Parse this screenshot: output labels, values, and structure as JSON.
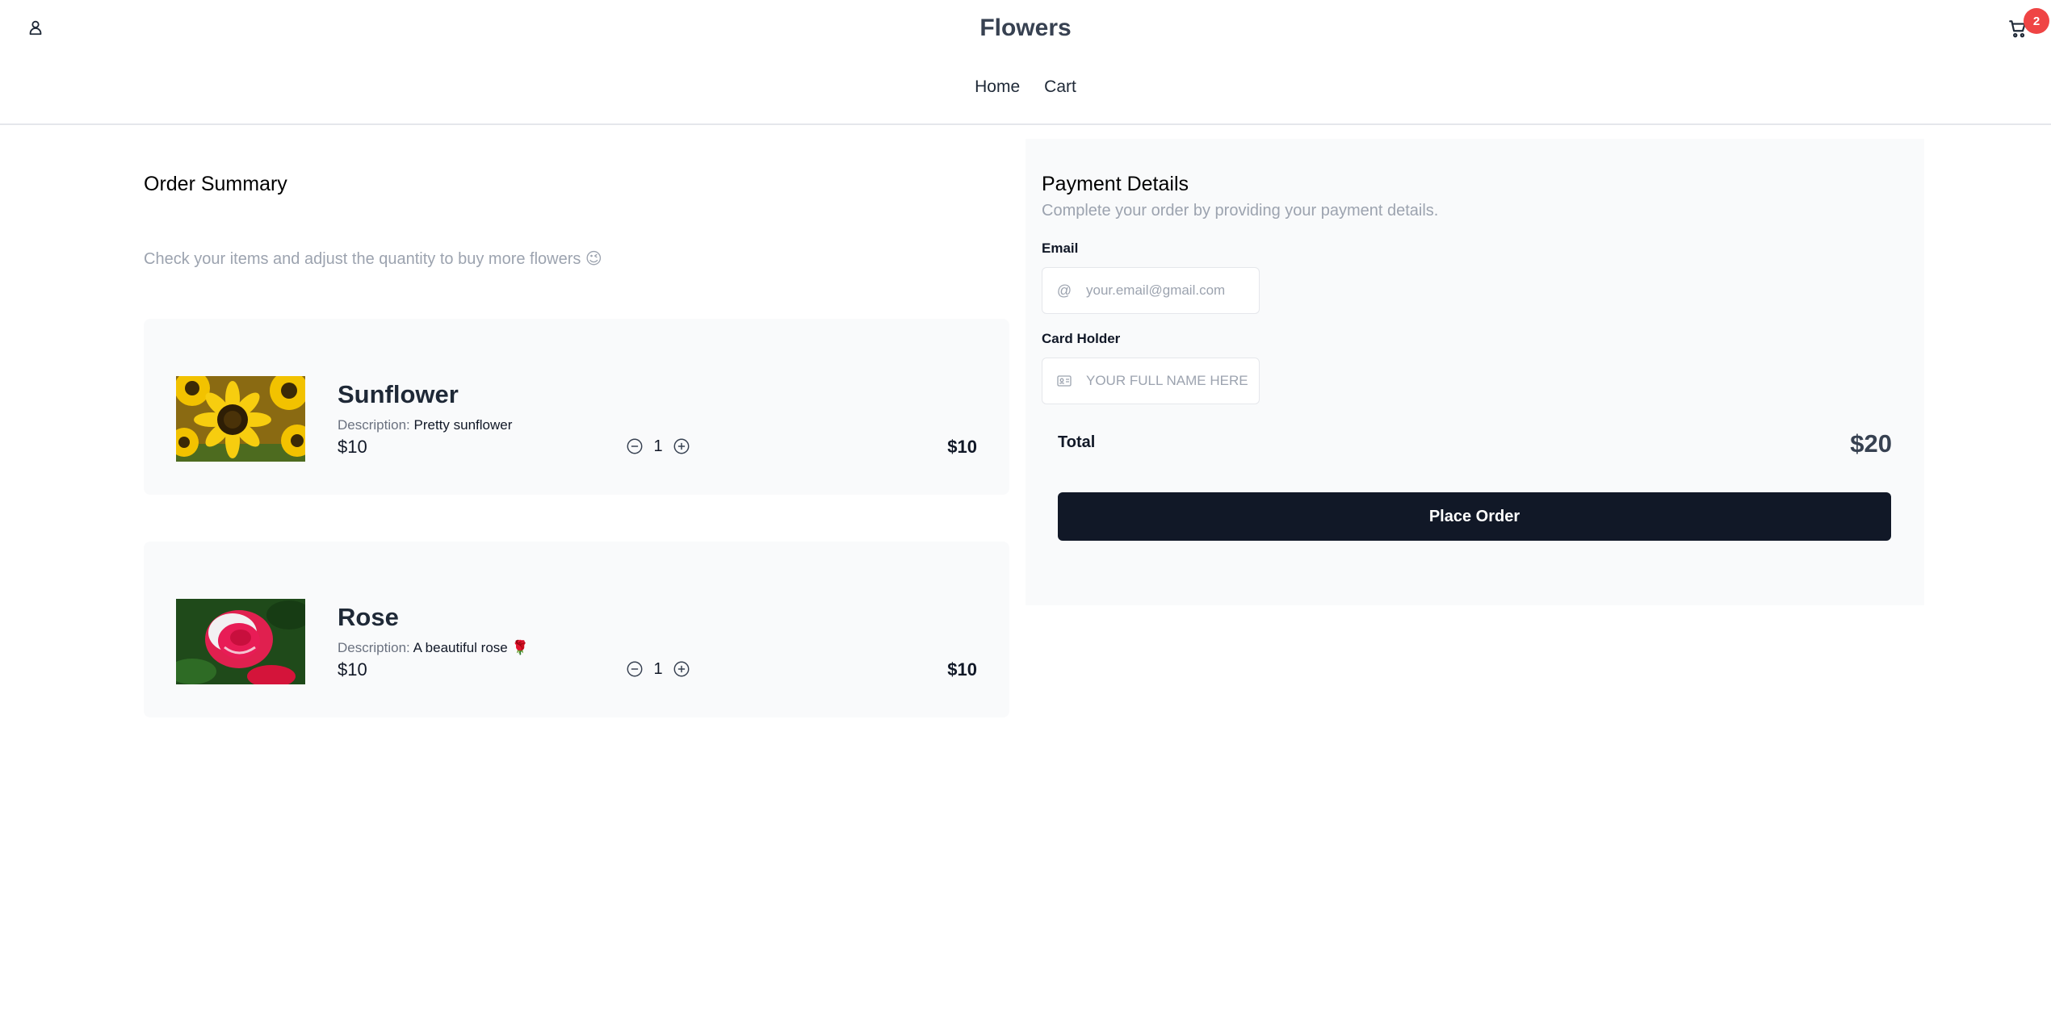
{
  "header": {
    "brand": "Flowers",
    "nav": [
      {
        "label": "Home"
      },
      {
        "label": "Cart"
      }
    ],
    "cart_count": "2"
  },
  "order": {
    "title": "Order Summary",
    "subtitle": "Check your items and adjust the quantity to buy more flowers 😉",
    "desc_label": "Description:",
    "items": [
      {
        "name": "Sunflower",
        "description": "Pretty sunflower",
        "price": "$10",
        "quantity": "1",
        "total": "$10"
      },
      {
        "name": "Rose",
        "description": "A beautiful rose 🌹",
        "price": "$10",
        "quantity": "1",
        "total": "$10"
      }
    ]
  },
  "payment": {
    "title": "Payment Details",
    "subtitle": "Complete your order by providing your payment details.",
    "email_label": "Email",
    "email_placeholder": "your.email@gmail.com",
    "holder_label": "Card Holder",
    "holder_placeholder": "YOUR FULL NAME HERE",
    "total_label": "Total",
    "total_value": "$20",
    "button_label": "Place Order"
  },
  "colors": {
    "badge": "#ef4444",
    "button": "#111827",
    "panel": "#f9fafb"
  }
}
